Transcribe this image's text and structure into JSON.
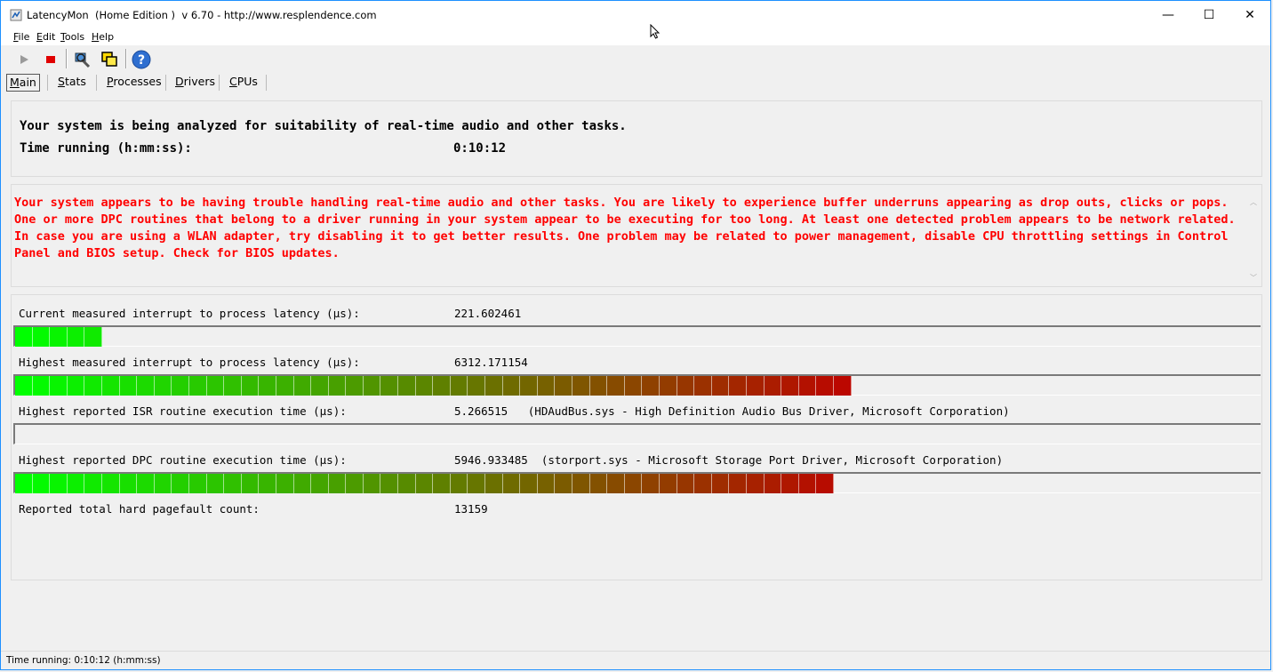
{
  "window": {
    "title": "LatencyMon  (Home Edition )  v 6.70 - http://www.resplendence.com",
    "minimize_glyph": "—",
    "maximize_glyph": "☐",
    "close_glyph": "✕"
  },
  "menu": {
    "file": {
      "first": "F",
      "rest": "ile"
    },
    "edit": {
      "first": "E",
      "rest": "dit"
    },
    "tools": {
      "first": "T",
      "rest": "ools"
    },
    "help": {
      "first": "H",
      "rest": "elp"
    }
  },
  "toolbar": {
    "icons": [
      "play-icon",
      "stop-icon",
      "analyze-icon",
      "copy-windows-icon",
      "help-icon"
    ]
  },
  "tabs": [
    {
      "first": "M",
      "rest": "ain",
      "active": true
    },
    {
      "first": "S",
      "rest": "tats"
    },
    {
      "first": "P",
      "rest": "rocesses"
    },
    {
      "first": "D",
      "rest": "rivers"
    },
    {
      "first": "C",
      "rest": "PUs"
    }
  ],
  "summary": {
    "line1": "Your system is being analyzed for suitability of real-time audio and other tasks.",
    "time_label": "Time running (h:mm:ss):",
    "time_value": "0:10:12"
  },
  "warning": {
    "text": "Your system appears to be having trouble handling real-time audio and other tasks. You are likely to experience buffer underruns appearing as drop outs, clicks or pops. One or more DPC routines that belong to a driver running in your system appear to be executing for too long. At least one detected problem appears to be network related. In case you are using a WLAN adapter, try disabling it to get better results. One problem may be related to power management, disable CPU throttling settings in Control Panel and BIOS setup. Check for BIOS updates.",
    "color": "#ff0000"
  },
  "metrics": [
    {
      "label": "Current measured interrupt to process latency (µs):",
      "value": "221.602461",
      "level": 0.069
    },
    {
      "label": "Highest measured interrupt to process latency (µs):",
      "value": "6312.171154",
      "level": 0.673
    },
    {
      "label": "Highest reported ISR routine execution time (µs):",
      "value": "5.266515   (HDAudBus.sys - High Definition Audio Bus Driver, Microsoft Corporation)",
      "level": 0.0
    },
    {
      "label": "Highest reported DPC routine execution time (µs):",
      "value": "5946.933485  (storport.sys - Microsoft Storage Port Driver, Microsoft Corporation)",
      "level": 0.661
    }
  ],
  "pagefault": {
    "label": "Reported total hard pagefault count:",
    "value": "13159"
  },
  "bar_colors": {
    "start": "#00ff00",
    "end": "#c00000"
  },
  "status": {
    "text": "Time running: 0:10:12  (h:mm:ss)"
  }
}
